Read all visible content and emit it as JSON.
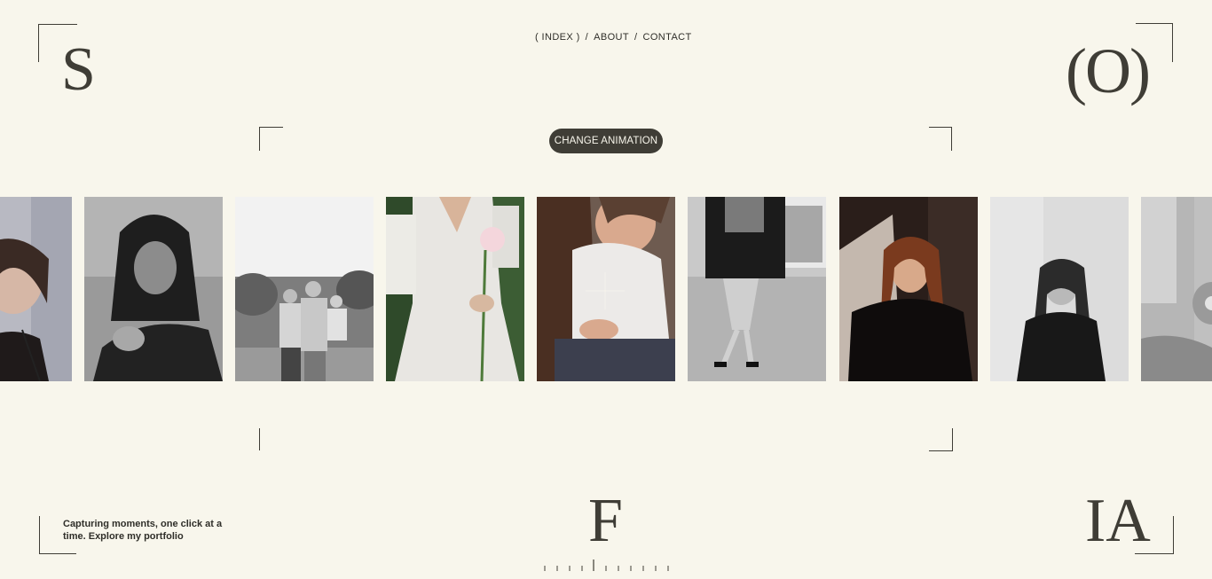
{
  "logo_letters": {
    "top_left": "S",
    "top_right": "(O)",
    "bottom_center": "F",
    "bottom_right": "IA"
  },
  "nav": {
    "items": [
      {
        "label": "( INDEX )"
      },
      {
        "label": "ABOUT"
      },
      {
        "label": "CONTACT"
      }
    ],
    "separator": "/"
  },
  "animation_button": {
    "label": "CHANGE ANIMATION"
  },
  "gallery": {
    "photos": [
      {
        "name": "woman-with-headband-portrait"
      },
      {
        "name": "woman-dark-hair-bw-portrait"
      },
      {
        "name": "family-outdoor-bw"
      },
      {
        "name": "woman-white-dress-peony"
      },
      {
        "name": "couple-embrace"
      },
      {
        "name": "woman-sitting-on-ledge-bw"
      },
      {
        "name": "woman-curly-red-hair"
      },
      {
        "name": "woman-long-hair-bw"
      },
      {
        "name": "partial-portrait-bw"
      }
    ]
  },
  "tagline": "Capturing moments, one click at a time. Explore my portfolio",
  "colors": {
    "background": "#f8f6ec",
    "ink": "#3f3d36",
    "button_text": "#f8f6ec"
  }
}
